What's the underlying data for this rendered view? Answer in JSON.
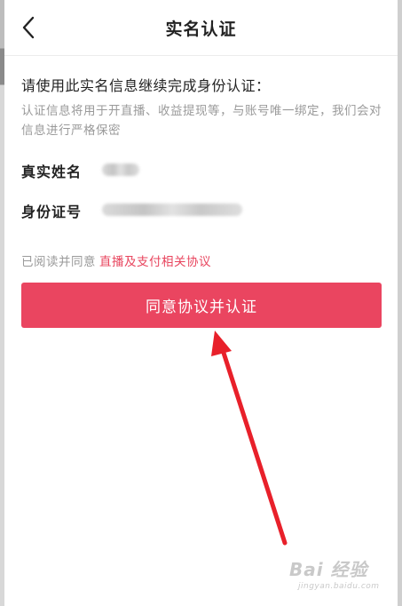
{
  "header": {
    "title": "实名认证",
    "back_icon": "chevron-left-icon"
  },
  "intro": {
    "heading": "请使用此实名信息继续完成身份认证：",
    "description": "认证信息将用于开直播、收益提现等，与账号唯一绑定，我们会对信息进行严格保密"
  },
  "form": {
    "name_label": "真实姓名",
    "id_label": "身份证号"
  },
  "agreement": {
    "prefix": "已阅读并同意",
    "link": "直播及支付相关协议"
  },
  "submit": {
    "label": "同意协议并认证"
  },
  "colors": {
    "accent": "#ea4560",
    "link": "#e8455e",
    "arrow": "#e8202a"
  },
  "watermark": {
    "main": "Bai 经验",
    "sub": "jingyan.baidu.com"
  }
}
